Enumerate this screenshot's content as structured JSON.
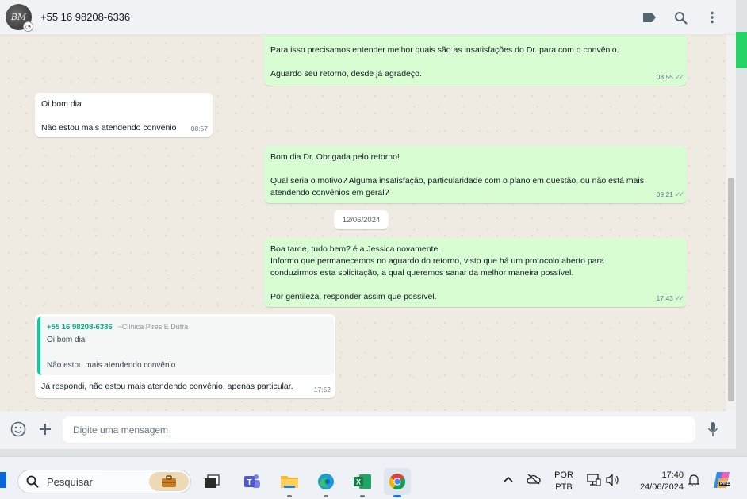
{
  "header": {
    "avatar_text": "BM",
    "contact_name": "+55 16 98208-6336",
    "icons": [
      "label-icon",
      "search-icon",
      "menu-icon"
    ]
  },
  "messages": [
    {
      "direction": "out",
      "text": "Para isso precisamos entender melhor quais são as insatisfações do Dr. para com o convênio.\n\nAguardo seu retorno, desde já agradeço.",
      "time": "08:55",
      "status": "read"
    },
    {
      "direction": "in",
      "text": "Oi bom dia\n\nNão estou mais atendendo convênio",
      "time": "08:57"
    },
    {
      "direction": "out",
      "text": "Bom dia Dr. Obrigada pelo retorno!\n\nQual seria o motivo? Alguma insatisfação, particularidade com o plano em questão, ou não está mais atendendo convênios em geral?",
      "time": "09:21",
      "status": "read"
    },
    {
      "direction": "out",
      "text": "Boa tarde, tudo bem? é a Jessica novamente.\nInformo que permanecemos no aguardo do retorno, visto que há um protocolo aberto para conduzirmos esta solicitação, a qual queremos sanar da melhor maneira possível.\n\nPor gentileza, responder assim que possível.",
      "time": "17:43",
      "status": "read"
    },
    {
      "direction": "in",
      "quoted": {
        "author": "+55 16 98208-6336",
        "pushname": "~Clínica Pires E Dutra",
        "text": "Oi bom dia\n\nNão estou mais atendendo convênio"
      },
      "text": "Já respondi, não estou mais atendendo convênio, apenas particular.",
      "time": "17:52"
    }
  ],
  "date_chip": "12/06/2024",
  "composer": {
    "placeholder": "Digite uma mensagem",
    "icons": [
      "emoji-icon",
      "plus-icon",
      "mic-icon"
    ]
  },
  "taskbar": {
    "search_label": "Pesquisar",
    "apps": [
      "task-view",
      "teams",
      "file-explorer",
      "edge",
      "excel",
      "chrome"
    ],
    "language": "POR",
    "keyboard": "PTB",
    "time": "17:40",
    "date": "24/06/2024",
    "copilot_badge": "PRE"
  },
  "colors": {
    "outgoing_bubble": "#d9fdd3",
    "incoming_bubble": "#ffffff",
    "chat_background": "#efeae2",
    "quote_accent": "#06cf9c"
  }
}
